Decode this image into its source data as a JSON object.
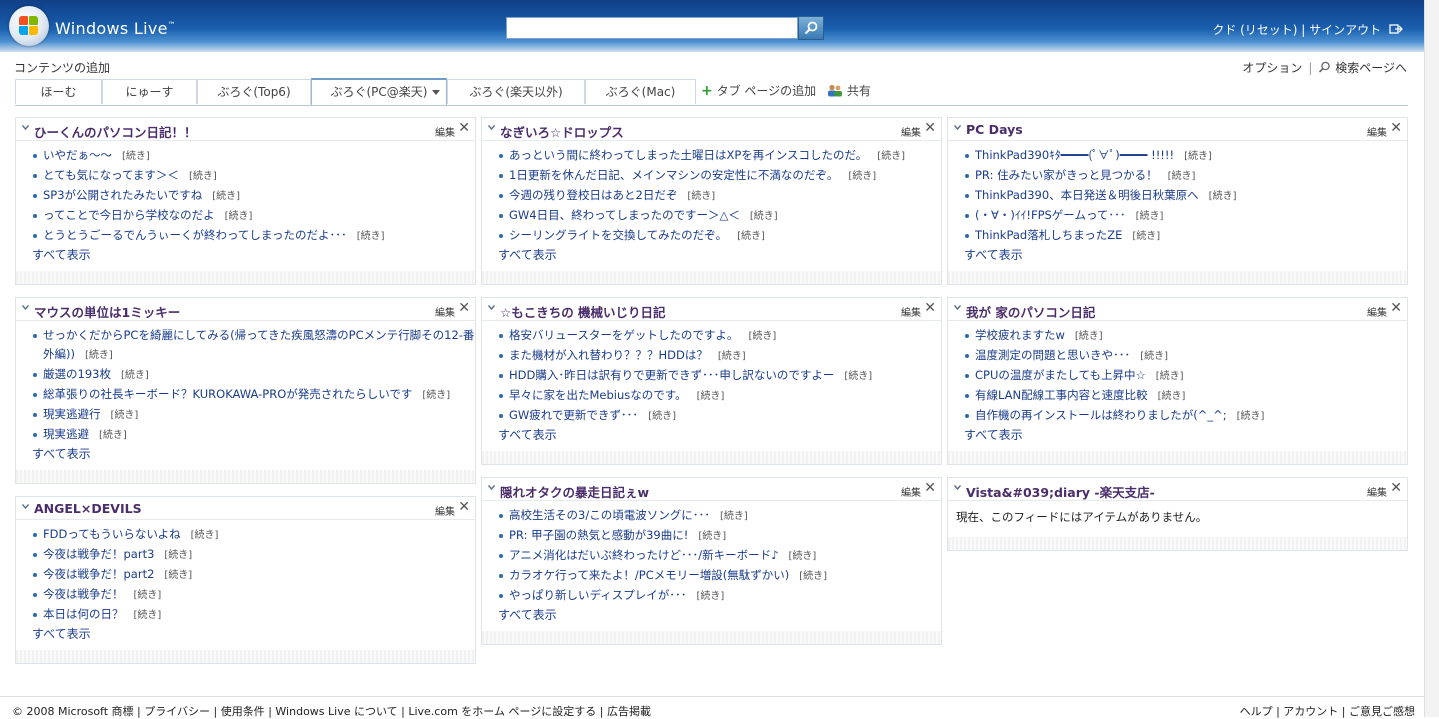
{
  "header": {
    "brand": "Windows Live",
    "brand_tm": "™",
    "user_links": "クド (リセット) | サインアウト"
  },
  "toolbar": {
    "add_content": "コンテンツの追加",
    "options": "オプション",
    "search_page": "検索ページへ"
  },
  "tabs": [
    {
      "label": "ほーむ"
    },
    {
      "label": "にゅーす"
    },
    {
      "label": "ぶろぐ(Top6)"
    },
    {
      "label": "ぶろぐ(PC@楽天)"
    },
    {
      "label": "ぶろぐ(楽天以外)"
    },
    {
      "label": "ぶろぐ(Mac)"
    }
  ],
  "tab_actions": {
    "add_tab": "タブ ページの追加",
    "share": "共有"
  },
  "panel_labels": {
    "edit": "編集",
    "close": "✕",
    "more": "[続き]",
    "show_all": "すべて表示"
  },
  "panels": [
    {
      "title": "ひーくんのパソコン日記！！",
      "items": [
        "いやだぁ〜〜",
        "とても気になってます＞＜",
        "SP3が公開されたみたいですね",
        "ってことで今日から学校なのだよ",
        "とうとうごーるでんうぃーくが終わってしまったのだよ･･･"
      ]
    },
    {
      "title": "なぎいろ☆ドロップス",
      "items": [
        "あっという間に終わってしまった土曜日はXPを再インスコしたのだ。",
        "1日更新を休んだ日記、メインマシンの安定性に不満なのだぞ。",
        "今週の残り登校日はあと2日だぞ",
        "GW4日目、終わってしまったのですー＞△＜",
        "シーリングライトを交換してみたのだぞ。"
      ]
    },
    {
      "title": "PC Days",
      "items": [
        "ThinkPad390ｷﾀ━━━━(ﾟ∀ﾟ)━━━━ !!!!!",
        "PR: 住みたい家がきっと見つかる！",
        "ThinkPad390、本日発送＆明後日秋葉原へ",
        "(・∀・)ｲｲ!FPSゲームって･･･",
        "ThinkPad落札しちまったZE"
      ]
    },
    {
      "title": "マウスの単位は1ミッキー",
      "items": [
        "せっかくだからPCを綺麗にしてみる(帰ってきた疾風怒濤のPCメンテ行脚その12-番外編))",
        "厳選の193枚",
        "総革張りの社長キーボード？KUROKAWA-PROが発売されたらしいです",
        "現実逃避行",
        "現実逃避"
      ]
    },
    {
      "title": "☆もこきちの 機械いじり日記",
      "items": [
        "格安バリュースターをゲットしたのですよ。",
        "また機材が入れ替わり？？？HDDは？",
        "HDD購入･昨日は訳有りで更新できず･･･申し訳ないのですよー",
        "早々に家を出たMebiusなのです。",
        "GW疲れで更新できず･･･"
      ]
    },
    {
      "title": "我が 家のパソコン日記",
      "items": [
        "学校疲れますたw",
        "温度測定の問題と思いきや･･･",
        "CPUの温度がまたしても上昇中☆",
        "有線LAN配線工事内容と速度比較",
        "自作機の再インストールは終わりましたが(^_^;"
      ]
    },
    {
      "title": "ANGEL×DEVILS",
      "items": [
        "FDDってもういらないよね",
        "今夜は戦争だ！part3",
        "今夜は戦争だ！part2",
        "今夜は戦争だ！",
        "本日は何の日？"
      ]
    },
    {
      "title": "隠れオタクの暴走日記ぇw",
      "items": [
        "高校生活その3/この頃電波ソングに･･･",
        "PR: 甲子園の熱気と感動が39曲に!",
        "アニメ消化はだいぶ終わったけど･･･/新キーボード♪",
        "カラオケ行って来たよ！/PCメモリー増設(無駄ずかい)",
        "やっぱり新しいディスプレイが･･･"
      ]
    },
    {
      "title": "Vista&#039;diary -楽天支店-",
      "items": [],
      "empty_text": "現在、このフィードにはアイテムがありません。"
    }
  ],
  "footer": {
    "left": "© 2008 Microsoft   商標 | プライバシー | 使用条件 | Windows Live について   | Live.com をホーム ページに設定する | 広告掲載",
    "right": "ヘルプ | アカウント | ご意見ご感想"
  },
  "colors": {
    "header_dark": "#0f3f87",
    "panel_title": "#4a2d6b",
    "link": "#1a3c8c",
    "add_tab_plus": "#2e9a2e"
  }
}
